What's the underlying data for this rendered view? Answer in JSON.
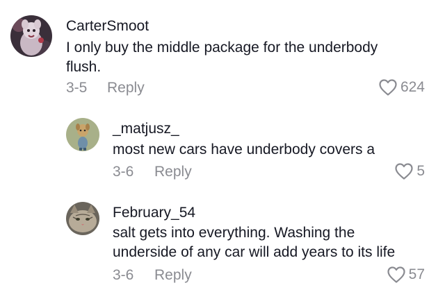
{
  "comments": [
    {
      "username": "CarterSmoot",
      "text_line1": "I only buy the middle package for the underbody",
      "text_line2": "flush.",
      "date": "3-5",
      "reply_label": "Reply",
      "likes": "624",
      "avatar_icon": "avatar-figure-icon"
    },
    {
      "username": "_matjusz_",
      "text_line1": "most new cars have underbody covers a",
      "date": "3-6",
      "reply_label": "Reply",
      "likes": "5",
      "avatar_icon": "avatar-cartoon-icon"
    },
    {
      "username": "February_54",
      "text_line1": "salt gets into everything. Washing the",
      "text_line2": "underside of any car will add years to its life",
      "date": "3-6",
      "reply_label": "Reply",
      "likes": "57",
      "avatar_icon": "avatar-cat-icon"
    }
  ],
  "colors": {
    "text": "#161823",
    "muted": "#8a8b91",
    "background": "#ffffff"
  }
}
